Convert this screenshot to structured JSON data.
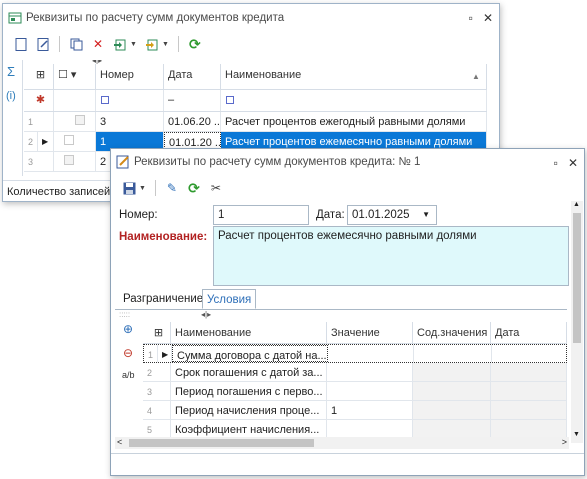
{
  "bg_window": {
    "title": "Реквизиты по расчету сумм документов кредита",
    "columns": [
      "Номер",
      "Дата",
      "Наименование"
    ],
    "rows": [
      {
        "rownum": "1",
        "number": "3",
        "date": "01.06.20 ...",
        "name": "Расчет процентов ежегодный равными долями"
      },
      {
        "rownum": "2",
        "number": "1",
        "date": "01.01.20 ...",
        "name": "Расчет процентов ежемесячно равными долями"
      },
      {
        "rownum": "3",
        "number": "2",
        "date": "",
        "name": ""
      }
    ],
    "status": "Количество записей",
    "colors": {
      "selection": "#0a78d7"
    }
  },
  "fg_window": {
    "title": "Реквизиты по расчету сумм документов кредита: № 1",
    "number_label": "Номер:",
    "number_value": "1",
    "date_label": "Дата:",
    "date_value": "01.01.2025",
    "name_label": "Наименование:",
    "name_value": "Расчет процентов ежемесячно равными долями",
    "tabs": [
      "Разграничение",
      "Условия"
    ],
    "active_tab": "Условия",
    "cond_columns": [
      "Наименование",
      "Значение",
      "Сод.значения",
      "Дата"
    ],
    "cond_rows": [
      {
        "rownum": "1",
        "name": "Сумма договора с датой на...",
        "value": ""
      },
      {
        "rownum": "2",
        "name": "Срок погашения с датой за...",
        "value": ""
      },
      {
        "rownum": "3",
        "name": "Период погашения с перво...",
        "value": ""
      },
      {
        "rownum": "4",
        "name": "Период начисления проце...",
        "value": "1"
      },
      {
        "rownum": "5",
        "name": "Коэффициент начисления...",
        "value": ""
      }
    ],
    "colors": {
      "name_bg": "#dff9fb",
      "name_label": "#b22222"
    }
  }
}
